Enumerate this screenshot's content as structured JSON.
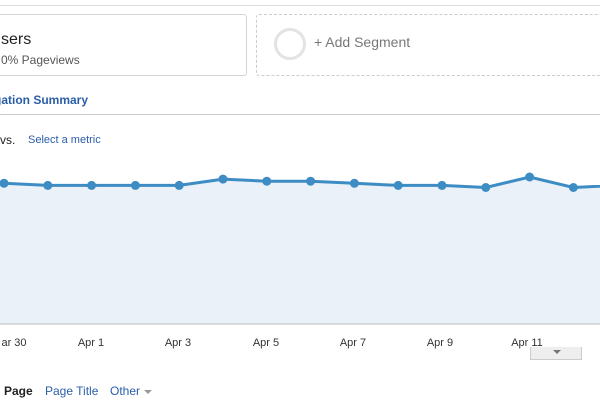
{
  "segment": {
    "title": "sers",
    "subtitle": "0% Pageviews"
  },
  "add_segment": {
    "label": "+ Add Segment"
  },
  "section": {
    "title": "gation Summary"
  },
  "metric_controls": {
    "vs": "vs.",
    "select_metric": "Select a metric"
  },
  "dimensions": {
    "active": "Page",
    "page_title": "Page Title",
    "other": "Other"
  },
  "colors": {
    "line": "#3d8cc4",
    "area": "#eaf1f9",
    "link": "#2a5ea8"
  },
  "chart_data": {
    "type": "area",
    "x_ticks": [
      "ar 30",
      "Apr 1",
      "Apr 3",
      "Apr 5",
      "Apr 7",
      "Apr 9",
      "Apr 11"
    ],
    "values": [
      67,
      66,
      66,
      66,
      66,
      69,
      68,
      68,
      67,
      66,
      66,
      65,
      70,
      65,
      66
    ],
    "y_range": [
      0,
      100
    ],
    "grid": true
  }
}
